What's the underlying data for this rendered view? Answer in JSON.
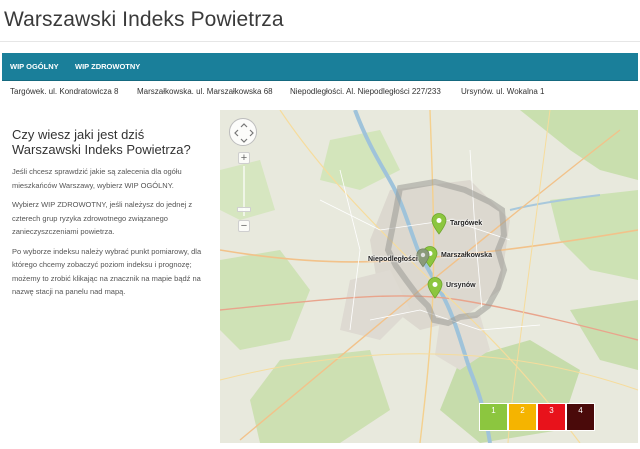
{
  "header": {
    "title": "Warszawski Indeks Powietrza"
  },
  "nav": {
    "items": [
      {
        "label": "WIP OGÓLNY"
      },
      {
        "label": "WIP ZDROWOTNY"
      }
    ]
  },
  "stations": [
    {
      "label": "Targówek. ul. Kondratowicza 8"
    },
    {
      "label": "Marszałkowska. ul. Marszałkowska 68"
    },
    {
      "label": "Niepodległości. Al. Niepodległości 227/233"
    },
    {
      "label": "Ursynów. ul. Wokalna 1"
    }
  ],
  "info": {
    "heading": "Czy wiesz jaki jest dziś Warszawski Indeks Powietrza?",
    "paragraphs": [
      "Jeśli chcesz sprawdzić jakie są zalecenia dla ogółu mieszkańców Warszawy, wybierz WIP OGÓLNY.",
      "Wybierz WIP ZDROWOTNY, jeśli należysz do jednej z czterech grup ryzyka zdrowotnego związanego zanieczyszczeniami powietrza.",
      "Po wyborze indeksu należy wybrać punkt pomiarowy, dla którego chcemy zobaczyć poziom indeksu i prognozę; możemy to zrobić klikając na znacznik na mapie bądź na nazwę stacji na panelu nad mapą."
    ]
  },
  "map": {
    "controls": {
      "zoom_in": "+",
      "zoom_out": "−"
    },
    "markers": [
      {
        "label": "Targówek",
        "color": "#8cc63f"
      },
      {
        "label": "Marszałkowska",
        "color": "#8cc63f"
      },
      {
        "label": "Niepodległości",
        "color": "#8a9a7a"
      },
      {
        "label": "Ursynów",
        "color": "#8cc63f"
      }
    ],
    "legend": [
      {
        "label": "1",
        "color": "#8cc63f"
      },
      {
        "label": "2",
        "color": "#f5b400"
      },
      {
        "label": "3",
        "color": "#e8121b"
      },
      {
        "label": "4",
        "color": "#4a0a0a"
      }
    ]
  }
}
